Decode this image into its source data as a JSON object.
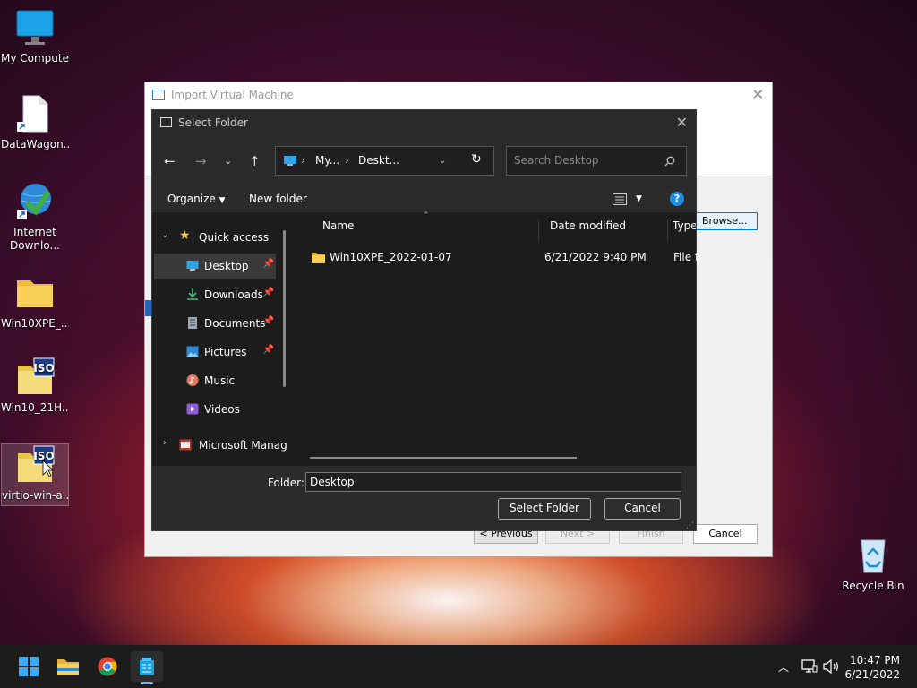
{
  "desktop": {
    "icons": [
      {
        "label": "My Computer"
      },
      {
        "label": "DataWagon..."
      },
      {
        "label": "Internet\nDownlo..."
      },
      {
        "label": "Win10XPE_..."
      },
      {
        "label": "Win10_21H..."
      },
      {
        "label": "virtio-win-a..."
      },
      {
        "label": "Recycle Bin"
      }
    ]
  },
  "wizard": {
    "title": "Import Virtual Machine",
    "close": "✕",
    "browse": "Browse...",
    "previous": "< Previous",
    "next": "Next >",
    "finish": "Finish",
    "cancel": "Cancel"
  },
  "dialog": {
    "title": "Select Folder",
    "close": "✕",
    "address": {
      "segment1": "My...",
      "segment2": "Deskt..."
    },
    "search_placeholder": "Search Desktop",
    "toolbar": {
      "organize": "Organize",
      "new_folder": "New folder"
    },
    "nav": {
      "quick_access": "Quick access",
      "items": [
        {
          "label": "Desktop",
          "pinned": true
        },
        {
          "label": "Downloads",
          "pinned": true
        },
        {
          "label": "Documents",
          "pinned": true
        },
        {
          "label": "Pictures",
          "pinned": true
        },
        {
          "label": "Music",
          "pinned": false
        },
        {
          "label": "Videos",
          "pinned": false
        }
      ],
      "microsoft": "Microsoft Manag"
    },
    "columns": {
      "name": "Name",
      "date": "Date modified",
      "type": "Type"
    },
    "files": [
      {
        "name": "Win10XPE_2022-01-07",
        "date": "6/21/2022 9:40 PM",
        "type": "File fo"
      }
    ],
    "folder_label": "Folder:",
    "folder_value": "Desktop",
    "select_button": "Select Folder",
    "cancel_button": "Cancel"
  },
  "taskbar": {
    "time": "10:47 PM",
    "date": "6/21/2022"
  },
  "colors": {
    "accent": "#0078d7",
    "folder": "#f5c542",
    "dialog_bg": "#202020"
  }
}
